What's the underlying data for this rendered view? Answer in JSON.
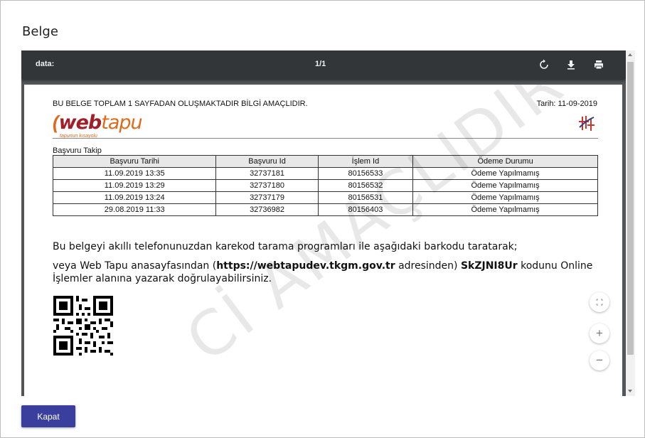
{
  "dialog": {
    "title": "Belge",
    "close_button": "Kapat"
  },
  "toolbar": {
    "title": "data:",
    "page_indicator": "1/1",
    "icons": [
      "rotate-icon",
      "download-icon",
      "print-icon"
    ]
  },
  "document": {
    "header_text": "BU BELGE TOPLAM 1 SAYFADAN OLUŞMAKTADIR BİLGİ AMAÇLIDIR.",
    "date_text": "Tarih: 11-09-2019",
    "logo": {
      "part1": "web",
      "part2": "tapu",
      "tagline": "tapunun kısayolu"
    },
    "section_title": "Başvuru Takip",
    "table": {
      "headers": [
        "Başvuru Tarihi",
        "Başvuru Id",
        "İşlem Id",
        "Ödeme Durumu"
      ],
      "rows": [
        [
          "11.09.2019 13:35",
          "32737181",
          "80156533",
          "Ödeme Yapılmamış"
        ],
        [
          "11.09.2019 13:29",
          "32737180",
          "80156532",
          "Ödeme Yapılmamış"
        ],
        [
          "11.09.2019 13:24",
          "32737179",
          "80156531",
          "Ödeme Yapılmamış"
        ],
        [
          "29.08.2019 11:33",
          "32736982",
          "80156403",
          "Ödeme Yapılmamış"
        ]
      ]
    },
    "verify_line1": "Bu belgeyi akıllı telefonunuzdan karekod tarama programları ile aşağıdaki barkodu taratarak;",
    "verify_line2_a": "veya Web Tapu anasayfasından (",
    "verify_url": "https://webtapudev.tkgm.gov.tr",
    "verify_line2_b": " adresinden) ",
    "verify_code": "SkZJNI8Ur",
    "verify_line2_c": " kodunu Online İşlemler alanına yazarak doğrulayabilirsiniz.",
    "watermark": "Cİ AMAÇLIDIR"
  },
  "zoom": {
    "fit_icon": "fit-page-icon",
    "zoom_in": "+",
    "zoom_out": "−"
  },
  "colors": {
    "toolbar_bg": "#323639",
    "viewer_bg": "#525659",
    "primary_button": "#3a3f9e",
    "logo_red": "#a0202a",
    "logo_orange": "#e06a1b"
  }
}
